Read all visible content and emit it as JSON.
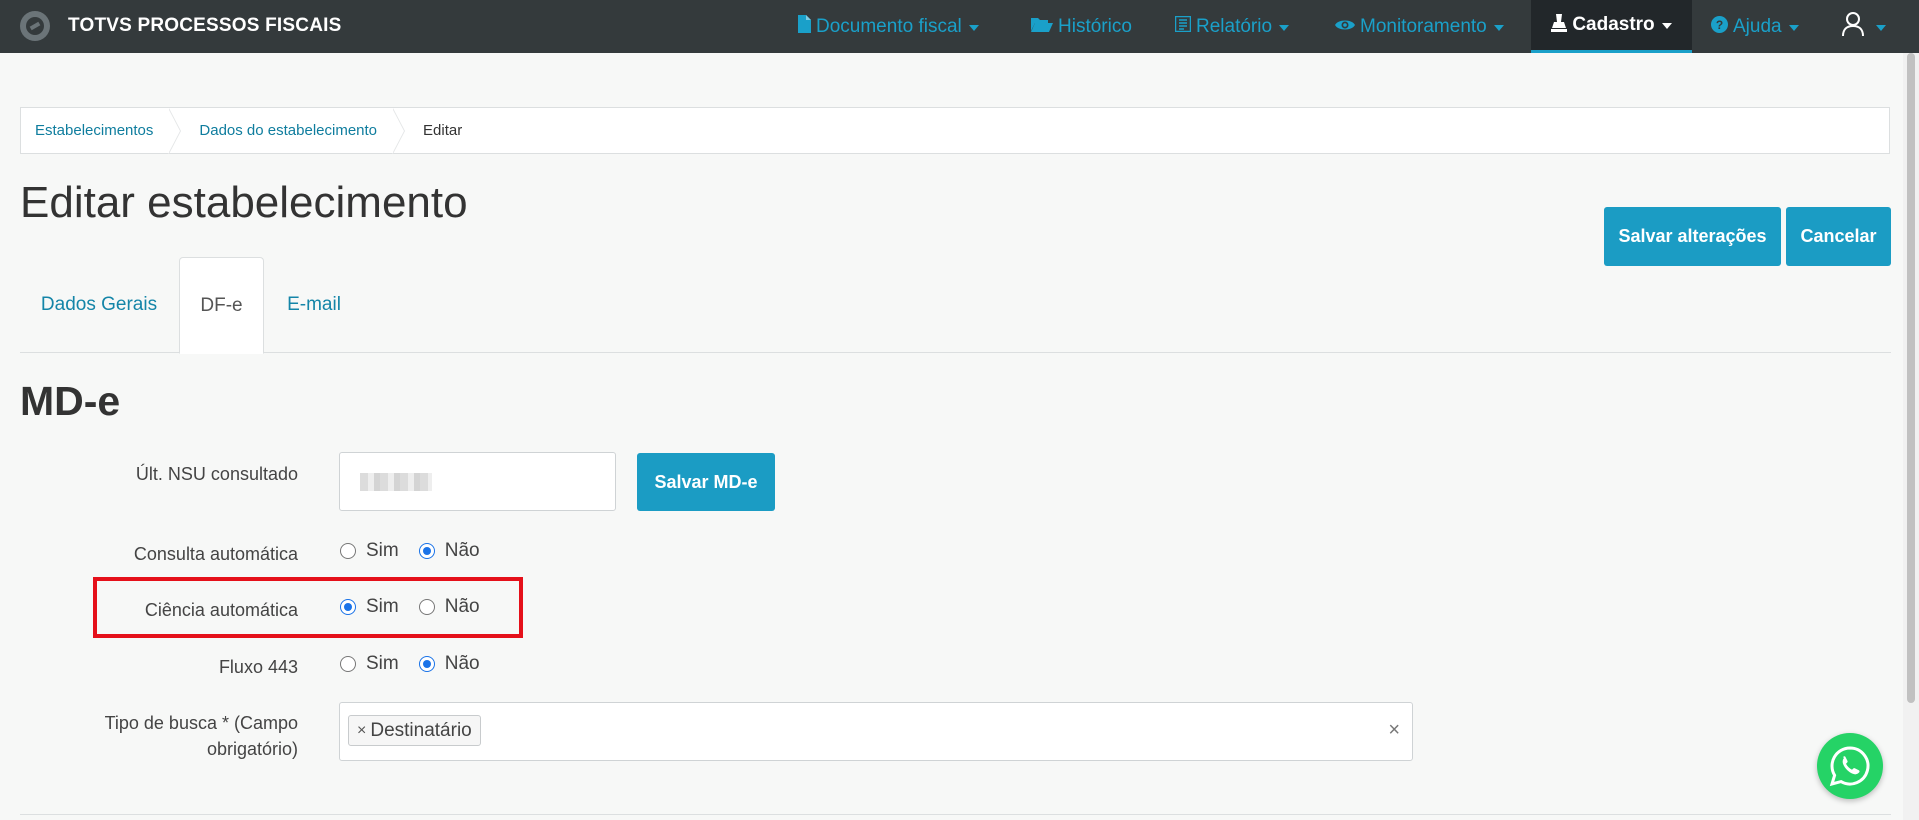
{
  "app": {
    "name": "TOTVS PROCESSOS FISCAIS"
  },
  "nav": {
    "items": [
      {
        "label": "Documento fiscal",
        "icon": "file-icon",
        "has_caret": true
      },
      {
        "label": "Histórico",
        "icon": "folder-open-icon",
        "has_caret": false
      },
      {
        "label": "Relatório",
        "icon": "report-icon",
        "has_caret": true
      },
      {
        "label": "Monitoramento",
        "icon": "eye-icon",
        "has_caret": true
      },
      {
        "label": "Cadastro",
        "icon": "stamp-icon",
        "has_caret": true,
        "active": true
      },
      {
        "label": "Ajuda",
        "icon": "question-circle-icon",
        "has_caret": true
      },
      {
        "label": "",
        "icon": "user-icon",
        "has_caret": true
      }
    ]
  },
  "breadcrumb": {
    "items": [
      "Estabelecimentos",
      "Dados do estabelecimento",
      "Editar"
    ]
  },
  "page": {
    "title": "Editar estabelecimento",
    "save_label": "Salvar alterações",
    "cancel_label": "Cancelar"
  },
  "tabs": [
    {
      "label": "Dados Gerais",
      "active": false
    },
    {
      "label": "DF-e",
      "active": true
    },
    {
      "label": "E-mail",
      "active": false
    }
  ],
  "mde": {
    "title": "MD-e",
    "nsu_label": "Últ. NSU consultado",
    "nsu_value_masked": true,
    "save_button": "Salvar MD-e",
    "consulta_label": "Consulta automática",
    "ciencia_label": "Ciência automática",
    "fluxo_label": "Fluxo 443",
    "tipo_label_line1": "Tipo de busca * (Campo",
    "tipo_label_line2": "obrigatório)",
    "option_sim": "Sim",
    "option_nao": "Não",
    "consulta_selected": "Não",
    "ciencia_selected": "Sim",
    "fluxo_selected": "Não",
    "tipo_tags": [
      "Destinatário"
    ],
    "tag_remove_glyph": "×",
    "clear_glyph": "×"
  },
  "colors": {
    "navbar_bg": "#343a3c",
    "accent": "#1b9cc4",
    "highlight": "#e5101a",
    "whatsapp": "#25d366"
  }
}
